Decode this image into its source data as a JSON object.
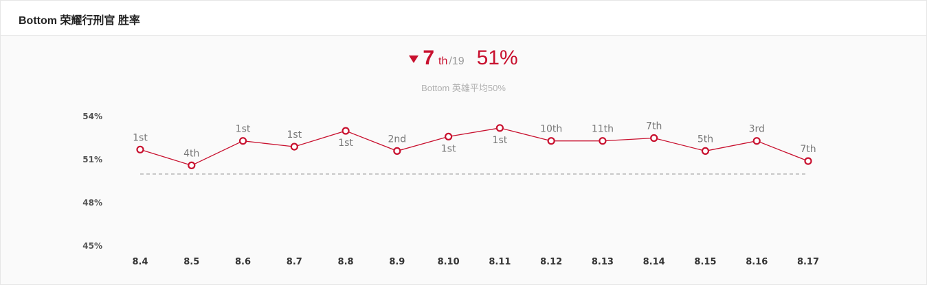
{
  "header": {
    "title": "Bottom 荣耀行刑官 胜率"
  },
  "summary": {
    "trend_icon": "down-triangle-icon",
    "rank": "7",
    "rank_suffix": "th",
    "rank_total": "/19",
    "win_rate": "51%",
    "average_text": "Bottom 英雄平均50%"
  },
  "colors": {
    "accent": "#c8102e",
    "reference_line": "#aaaaaa"
  },
  "chart_data": {
    "type": "line",
    "title": "",
    "xlabel": "",
    "ylabel": "",
    "categories": [
      "8.4",
      "8.5",
      "8.6",
      "8.7",
      "8.8",
      "8.9",
      "8.10",
      "8.11",
      "8.12",
      "8.13",
      "8.14",
      "8.15",
      "8.16",
      "8.17"
    ],
    "series": [
      {
        "values": [
          51.7,
          50.6,
          52.3,
          51.9,
          53.0,
          51.6,
          52.6,
          53.2,
          52.3,
          52.3,
          52.5,
          51.6,
          52.3,
          50.9
        ],
        "point_labels": [
          "1st",
          "4th",
          "1st",
          "1st",
          "1st",
          "2nd",
          "1st",
          "1st",
          "10th",
          "11th",
          "7th",
          "5th",
          "3rd",
          "7th"
        ],
        "label_positions": [
          "above",
          "above",
          "above",
          "above",
          "below",
          "above",
          "below",
          "below",
          "above",
          "above",
          "above",
          "above",
          "above",
          "above"
        ]
      }
    ],
    "reference_line": {
      "value": 50,
      "style": "dashed"
    },
    "y_ticks": [
      "54%",
      "51%",
      "48%",
      "45%"
    ],
    "ylim": [
      45,
      54
    ],
    "grid": false,
    "legend": "none"
  }
}
